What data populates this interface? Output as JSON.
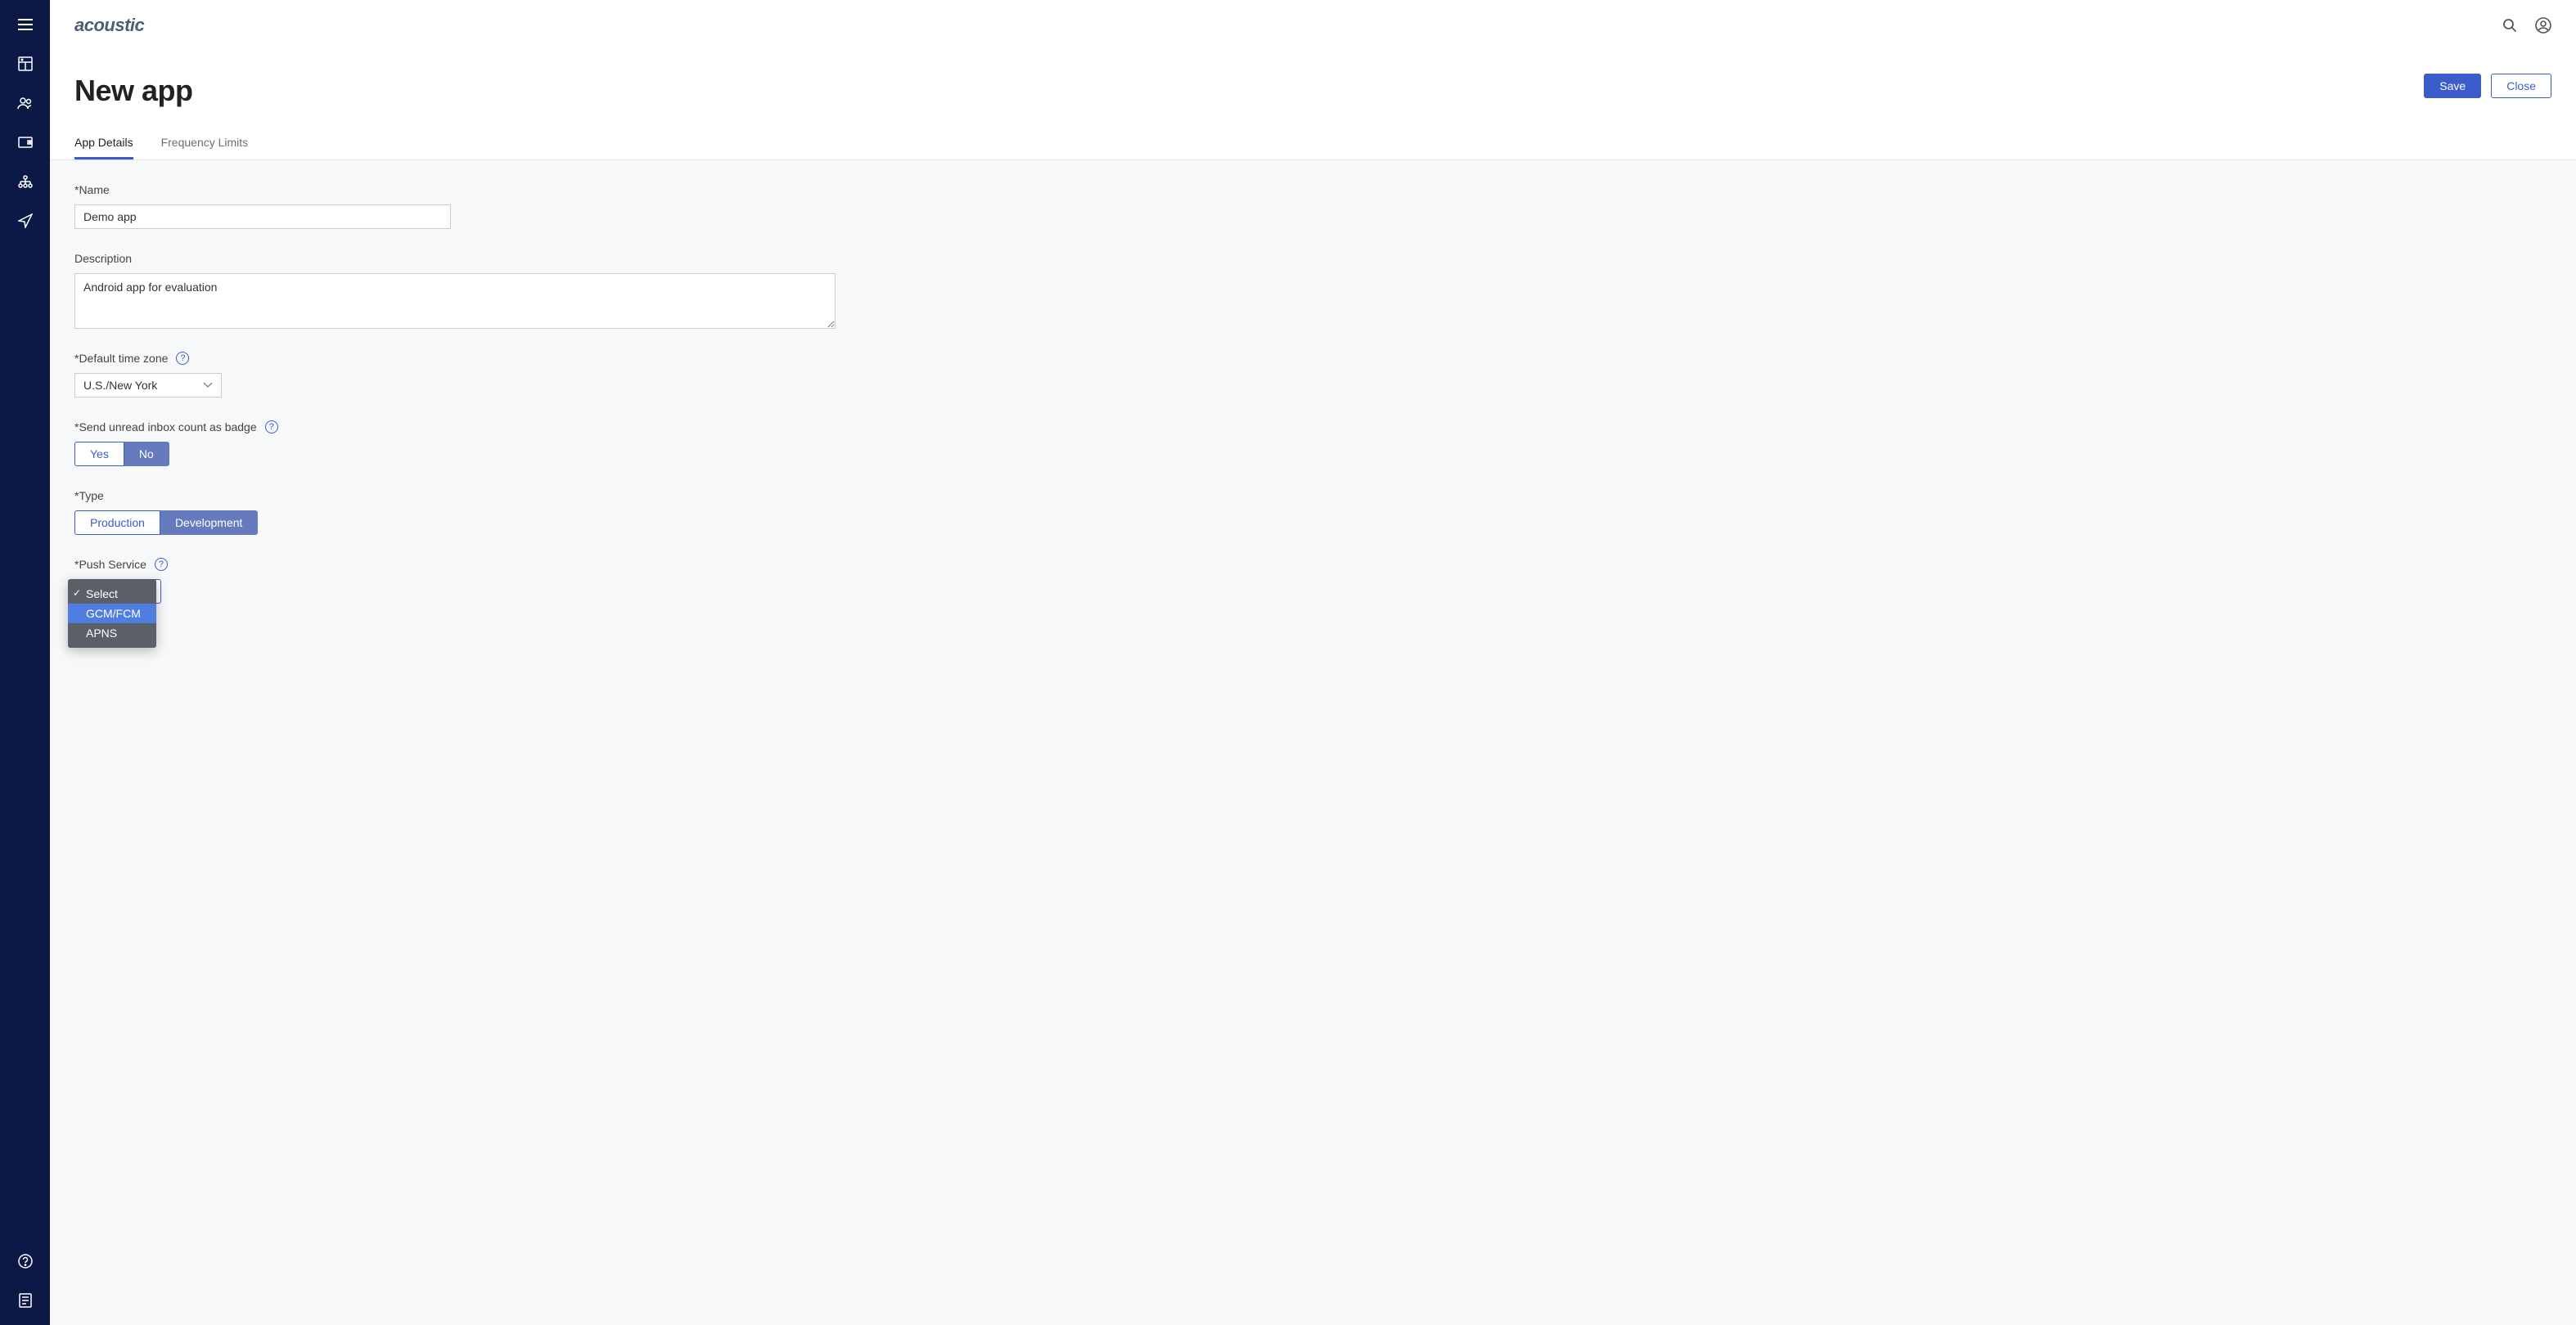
{
  "brand": "acoustic",
  "header": {
    "title": "New app",
    "save_label": "Save",
    "close_label": "Close"
  },
  "tabs": {
    "app_details": "App Details",
    "frequency_limits": "Frequency Limits"
  },
  "form": {
    "name": {
      "label": "*Name",
      "value": "Demo app"
    },
    "description": {
      "label": "Description",
      "value": "Android app for evaluation"
    },
    "timezone": {
      "label": "*Default time zone",
      "value": "U.S./New York"
    },
    "badge": {
      "label": "*Send unread inbox count as badge",
      "yes": "Yes",
      "no": "No"
    },
    "type": {
      "label": "*Type",
      "production": "Production",
      "development": "Development"
    },
    "push": {
      "label": "*Push Service",
      "selected": "Select",
      "options": {
        "select": "Select",
        "gcm": "GCM/FCM",
        "apns": "APNS"
      }
    }
  }
}
